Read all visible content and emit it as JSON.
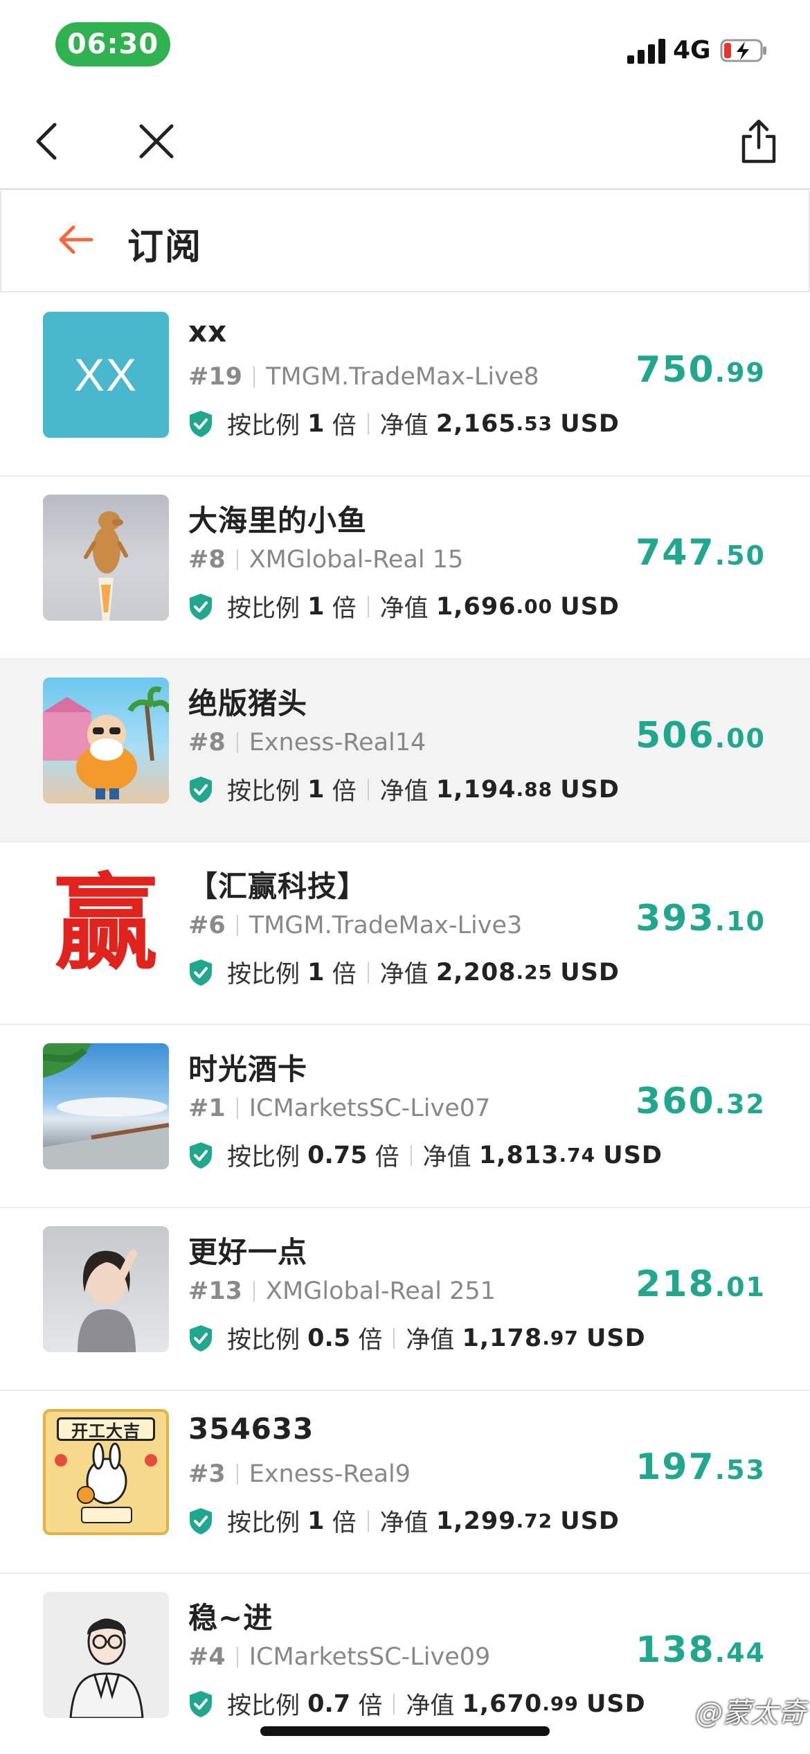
{
  "status_bar": {
    "time": "06:30",
    "network": "4G"
  },
  "header": {
    "title": "订阅"
  },
  "colors": {
    "accent_green": "#1fa88d",
    "status_green": "#2fb24f",
    "back_orange": "#f06a3c"
  },
  "rows": [
    {
      "name": "xx",
      "avatar_text": "XX",
      "rank": "#19",
      "server": "TMGM.TradeMax-Live8",
      "ratio_label": "按比例",
      "ratio": "1",
      "ratio_unit": "倍",
      "equity_label": "净值",
      "equity_int": "2,165",
      "equity_dec": ".53",
      "currency": "USD",
      "value_int": "750",
      "value_dec": ".99"
    },
    {
      "name": "大海里的小鱼",
      "rank": "#8",
      "server": "XMGlobal-Real 15",
      "ratio_label": "按比例",
      "ratio": "1",
      "ratio_unit": "倍",
      "equity_label": "净值",
      "equity_int": "1,696",
      "equity_dec": ".00",
      "currency": "USD",
      "value_int": "747",
      "value_dec": ".50"
    },
    {
      "name": "绝版猪头",
      "rank": "#8",
      "server": "Exness-Real14",
      "ratio_label": "按比例",
      "ratio": "1",
      "ratio_unit": "倍",
      "equity_label": "净值",
      "equity_int": "1,194",
      "equity_dec": ".88",
      "currency": "USD",
      "value_int": "506",
      "value_dec": ".00"
    },
    {
      "name": "【汇赢科技】",
      "avatar_text": "赢",
      "rank": "#6",
      "server": "TMGM.TradeMax-Live3",
      "ratio_label": "按比例",
      "ratio": "1",
      "ratio_unit": "倍",
      "equity_label": "净值",
      "equity_int": "2,208",
      "equity_dec": ".25",
      "currency": "USD",
      "value_int": "393",
      "value_dec": ".10"
    },
    {
      "name": "时光酒卡",
      "rank": "#1",
      "server": "ICMarketsSC-Live07",
      "ratio_label": "按比例",
      "ratio": "0.75",
      "ratio_unit": "倍",
      "equity_label": "净值",
      "equity_int": "1,813",
      "equity_dec": ".74",
      "currency": "USD",
      "value_int": "360",
      "value_dec": ".32"
    },
    {
      "name": "更好一点",
      "rank": "#13",
      "server": "XMGlobal-Real 251",
      "ratio_label": "按比例",
      "ratio": "0.5",
      "ratio_unit": "倍",
      "equity_label": "净值",
      "equity_int": "1,178",
      "equity_dec": ".97",
      "currency": "USD",
      "value_int": "218",
      "value_dec": ".01"
    },
    {
      "name": "354633",
      "avatar_text": "开工大吉",
      "rank": "#3",
      "server": "Exness-Real9",
      "ratio_label": "按比例",
      "ratio": "1",
      "ratio_unit": "倍",
      "equity_label": "净值",
      "equity_int": "1,299",
      "equity_dec": ".72",
      "currency": "USD",
      "value_int": "197",
      "value_dec": ".53"
    },
    {
      "name": "稳~进",
      "rank": "#4",
      "server": "ICMarketsSC-Live09",
      "ratio_label": "按比例",
      "ratio": "0.7",
      "ratio_unit": "倍",
      "equity_label": "净值",
      "equity_int": "1,670",
      "equity_dec": ".99",
      "currency": "USD",
      "value_int": "138",
      "value_dec": ".44"
    }
  ],
  "watermark": "@蒙太奇"
}
